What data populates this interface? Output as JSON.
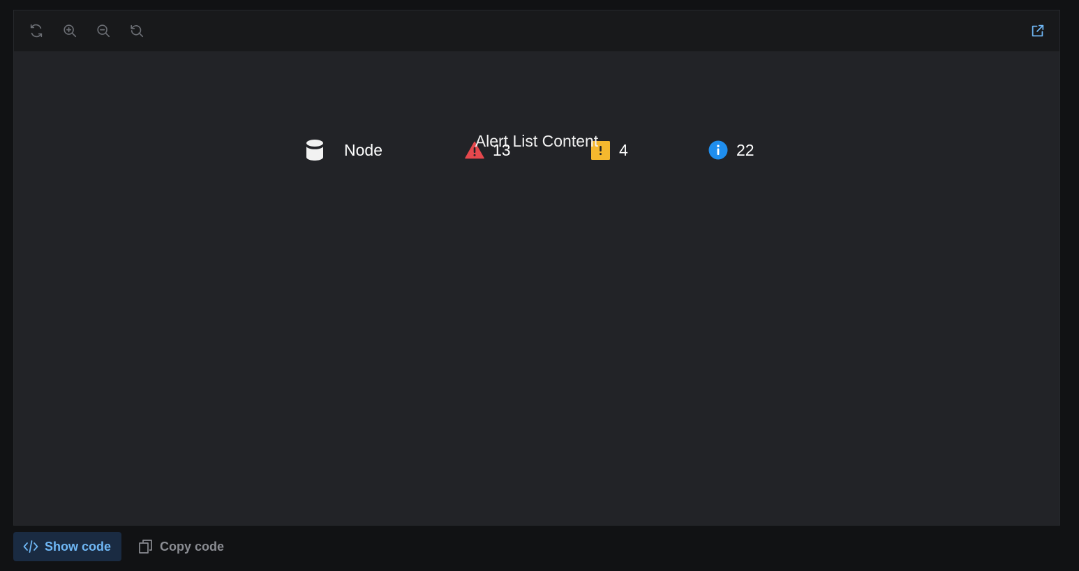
{
  "toolbar": {
    "icons": [
      "refresh-icon",
      "zoom-in-icon",
      "zoom-out-icon",
      "reset-zoom-icon",
      "external-link-icon"
    ]
  },
  "node": {
    "label": "Node",
    "critical_count": "13",
    "warning_count": "4",
    "info_count": "22"
  },
  "content_label": "Alert List Content",
  "footer": {
    "show_code_label": "Show code",
    "copy_code_label": "Copy code"
  },
  "colors": {
    "critical": "#e5484d",
    "warning": "#f5b82e",
    "info": "#1f8eee",
    "accent": "#6fb7f5"
  }
}
